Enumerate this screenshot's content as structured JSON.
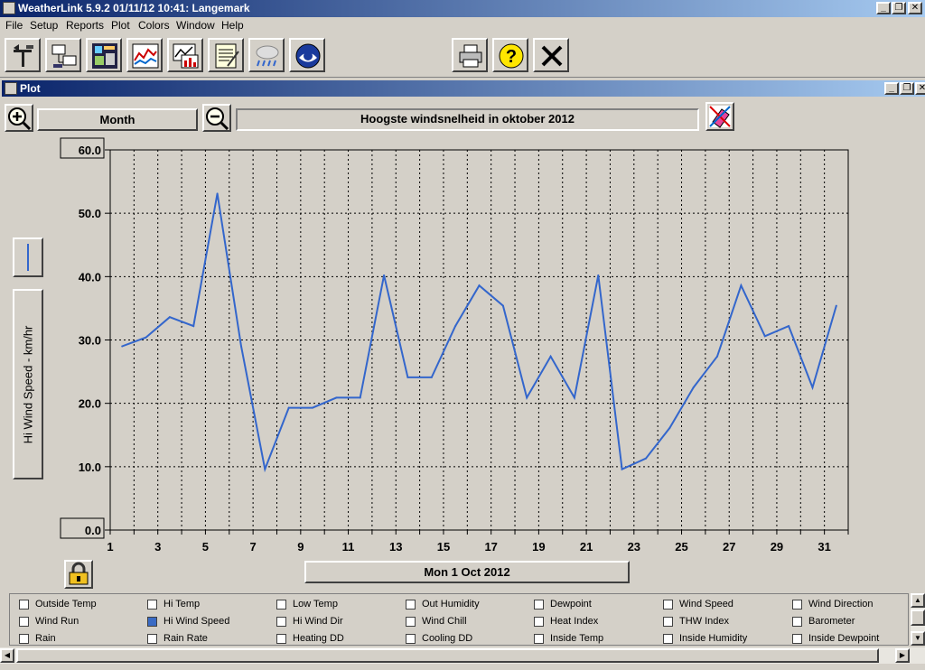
{
  "app": {
    "title": "WeatherLink 5.9.2  01/11/12  10:41: Langemark",
    "window_buttons": [
      "_",
      "❐",
      "✕"
    ]
  },
  "menu": [
    "File",
    "Setup",
    "Reports",
    "Plot",
    "Colors",
    "Window",
    "Help"
  ],
  "toolbar": {
    "buttons": [
      {
        "name": "station-icon"
      },
      {
        "name": "download-icon"
      },
      {
        "name": "bulletin-icon"
      },
      {
        "name": "strip-chart-icon"
      },
      {
        "name": "plot-icon"
      },
      {
        "name": "notes-icon"
      },
      {
        "name": "weather-icon"
      },
      {
        "name": "noaa-icon"
      },
      {
        "name": "print-icon"
      },
      {
        "name": "help-icon"
      },
      {
        "name": "exit-icon"
      }
    ]
  },
  "plot_window": {
    "title": "Plot",
    "period_label": "Month",
    "chart_title_value": "Hoogste windsnelheid in oktober 2012",
    "date_label": "Mon 1 Oct 2012"
  },
  "chart_data": {
    "type": "line",
    "title": "Hoogste windsnelheid in oktober 2012",
    "ylabel": "Hi Wind Speed - km/hr",
    "xlabel": "",
    "ylim": [
      0,
      60
    ],
    "xlim": [
      1,
      32
    ],
    "y_ticks": [
      "60.0",
      "50.0",
      "40.0",
      "30.0",
      "20.0",
      "10.0",
      "0.0"
    ],
    "x_ticks": [
      "1",
      "3",
      "5",
      "7",
      "9",
      "11",
      "13",
      "15",
      "17",
      "19",
      "21",
      "23",
      "25",
      "27",
      "29",
      "31"
    ],
    "grid": true,
    "color": "#3366cc",
    "series": [
      {
        "x": [
          1.5,
          2.5,
          3.5,
          4.5,
          5.5,
          6.5,
          7.5,
          8.5,
          9.5,
          10.5,
          11.5,
          12.5,
          13.5,
          14.5,
          15.5,
          16.5,
          17.5,
          18.5,
          19.5,
          20.5,
          21.5,
          22.5,
          23.5,
          24.5,
          25.5,
          26.5,
          27.5,
          28.5,
          29.5,
          30.5,
          31.5
        ],
        "values": [
          29.0,
          30.4,
          33.6,
          32.2,
          53.1,
          29.0,
          9.6,
          19.3,
          19.3,
          20.9,
          20.9,
          40.2,
          24.1,
          24.1,
          32.2,
          38.6,
          35.4,
          20.9,
          27.4,
          20.9,
          40.2,
          9.6,
          11.3,
          16.1,
          22.5,
          27.4,
          38.6,
          30.6,
          32.2,
          22.5,
          35.4
        ]
      }
    ]
  },
  "legend": [
    [
      {
        "label": "Outside Temp",
        "checked": false
      },
      {
        "label": "Hi Temp",
        "checked": false
      },
      {
        "label": "Low Temp",
        "checked": false
      },
      {
        "label": "Out Humidity",
        "checked": false
      },
      {
        "label": "Dewpoint",
        "checked": false
      },
      {
        "label": "Wind Speed",
        "checked": false
      },
      {
        "label": "Wind Direction",
        "checked": false
      }
    ],
    [
      {
        "label": "Wind Run",
        "checked": false
      },
      {
        "label": "Hi Wind Speed",
        "checked": true
      },
      {
        "label": "Hi Wind Dir",
        "checked": false
      },
      {
        "label": "Wind Chill",
        "checked": false
      },
      {
        "label": "Heat Index",
        "checked": false
      },
      {
        "label": "THW Index",
        "checked": false
      },
      {
        "label": "Barometer",
        "checked": false
      }
    ],
    [
      {
        "label": "Rain",
        "checked": false
      },
      {
        "label": "Rain Rate",
        "checked": false
      },
      {
        "label": "Heating DD",
        "checked": false
      },
      {
        "label": "Cooling DD",
        "checked": false
      },
      {
        "label": "Inside Temp",
        "checked": false
      },
      {
        "label": "Inside Humidity",
        "checked": false
      },
      {
        "label": "Inside Dewpoint",
        "checked": false
      }
    ]
  ]
}
